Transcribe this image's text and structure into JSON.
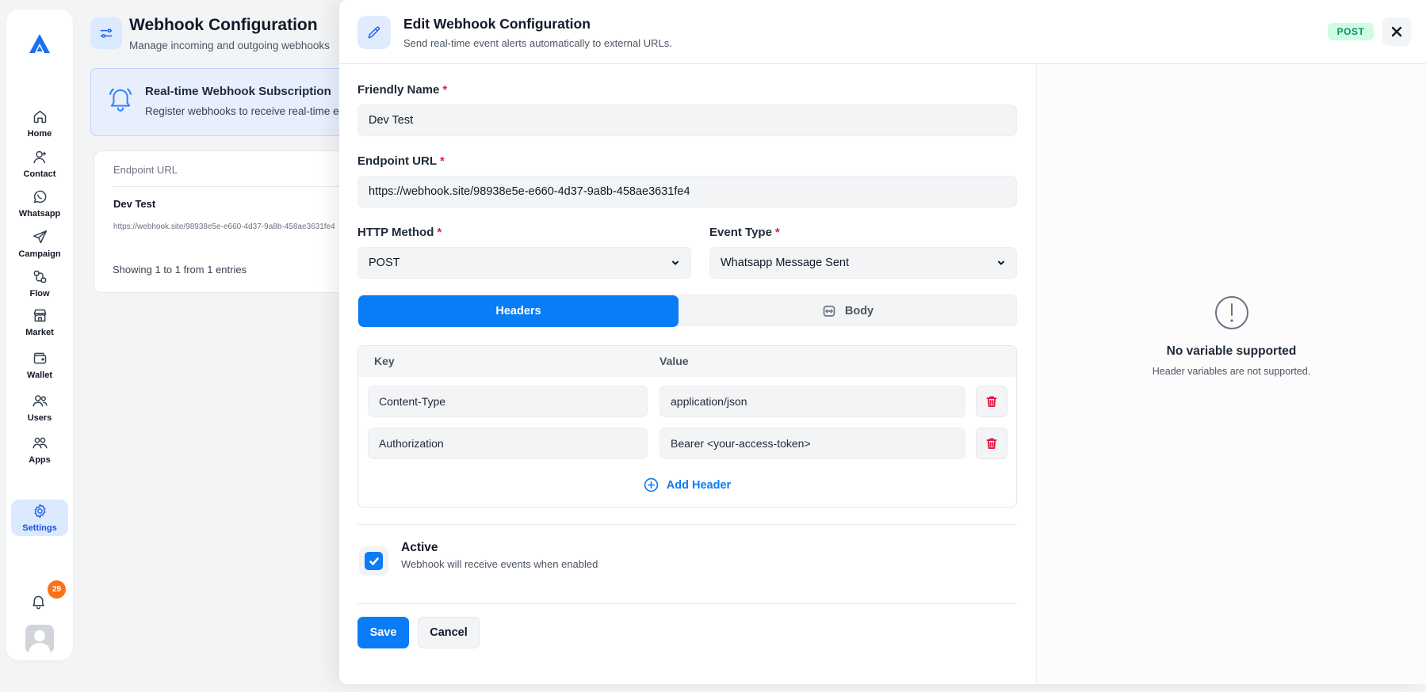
{
  "sidebar": {
    "items": [
      {
        "label": "Home",
        "icon": "home-icon"
      },
      {
        "label": "Contact",
        "icon": "contact-icon"
      },
      {
        "label": "Whatsapp",
        "icon": "whatsapp-icon"
      },
      {
        "label": "Campaign",
        "icon": "campaign-icon"
      },
      {
        "label": "Flow",
        "icon": "flow-icon"
      },
      {
        "label": "Market",
        "icon": "market-icon"
      },
      {
        "label": "Wallet",
        "icon": "wallet-icon"
      },
      {
        "label": "Users",
        "icon": "users-icon"
      },
      {
        "label": "Apps",
        "icon": "apps-icon"
      },
      {
        "label": "Settings",
        "icon": "gear-icon",
        "active": true
      }
    ],
    "notification_count": "29"
  },
  "page": {
    "title": "Webhook Configuration",
    "subtitle": "Manage incoming and outgoing webhooks",
    "banner": {
      "title": "Real-time Webhook Subscription",
      "description": "Register webhooks to receive real-time e"
    },
    "table": {
      "column_header": "Endpoint URL",
      "rows": [
        {
          "name": "Dev Test",
          "url": "https://webhook.site/98938e5e-e660-4d37-9a8b-458ae3631fe4"
        }
      ],
      "showing": "Showing 1 to 1 from 1 entries"
    }
  },
  "modal": {
    "title": "Edit Webhook Configuration",
    "subtitle": "Send real-time event alerts automatically to external URLs.",
    "method_badge": "POST",
    "fields": {
      "friendly_name": {
        "label": "Friendly Name",
        "required": "*",
        "value": "Dev Test"
      },
      "endpoint_url": {
        "label": "Endpoint URL",
        "required": "*",
        "value": "https://webhook.site/98938e5e-e660-4d37-9a8b-458ae3631fe4"
      },
      "http_method": {
        "label": "HTTP Method",
        "required": "*",
        "value": "POST"
      },
      "event_type": {
        "label": "Event Type",
        "required": "*",
        "value": "Whatsapp Message Sent"
      }
    },
    "tabs": [
      {
        "label": "Headers",
        "active": true
      },
      {
        "label": "Body",
        "active": false
      }
    ],
    "headers_table": {
      "key_header": "Key",
      "value_header": "Value",
      "rows": [
        {
          "key": "Content-Type",
          "value": "application/json"
        },
        {
          "key": "Authorization",
          "value": "Bearer <your-access-token>"
        }
      ],
      "add_label": "Add Header"
    },
    "active": {
      "title": "Active",
      "description": "Webhook will receive events when enabled",
      "checked": true
    },
    "actions": {
      "save": "Save",
      "cancel": "Cancel"
    },
    "side_panel": {
      "title": "No variable supported",
      "description": "Header variables are not supported."
    }
  },
  "colors": {
    "accent": "#0a7cf5",
    "danger": "#e11d48",
    "success_bg": "#d1fae5",
    "success_text": "#059669",
    "badge": "#f97316"
  }
}
